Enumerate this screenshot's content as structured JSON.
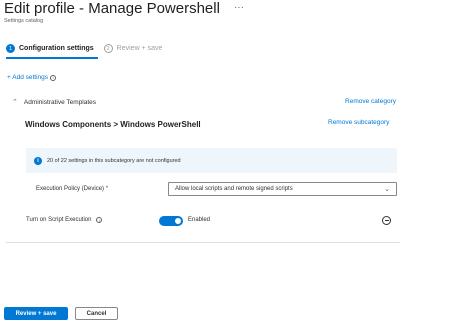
{
  "header": {
    "title": "Edit profile - Manage Powershell",
    "more_icon": "···",
    "subtitle": "Settings catalog"
  },
  "steps": [
    {
      "number": "1",
      "label": "Configuration settings",
      "active": true
    },
    {
      "number": "2",
      "label": "Review + save",
      "active": false
    }
  ],
  "add_settings": "+ Add settings",
  "category": {
    "label": "Administrative Templates",
    "remove_label": "Remove category"
  },
  "subcategory": {
    "title": "Windows Components > Windows PowerShell",
    "remove_label": "Remove subcategory"
  },
  "banner": {
    "icon": "i",
    "text": "20 of 22 settings in this subcategory are not configured"
  },
  "settings": {
    "execution_policy": {
      "label": "Execution Policy (Device)",
      "required_mark": "*",
      "value": "Allow local scripts and remote signed scripts"
    },
    "script_execution": {
      "label": "Turn on Script Execution",
      "state": "Enabled",
      "enabled": true
    }
  },
  "footer": {
    "review_label": "Review + save",
    "cancel_label": "Cancel"
  },
  "colors": {
    "accent": "#0078d4",
    "banner_bg": "#eef6fc"
  }
}
